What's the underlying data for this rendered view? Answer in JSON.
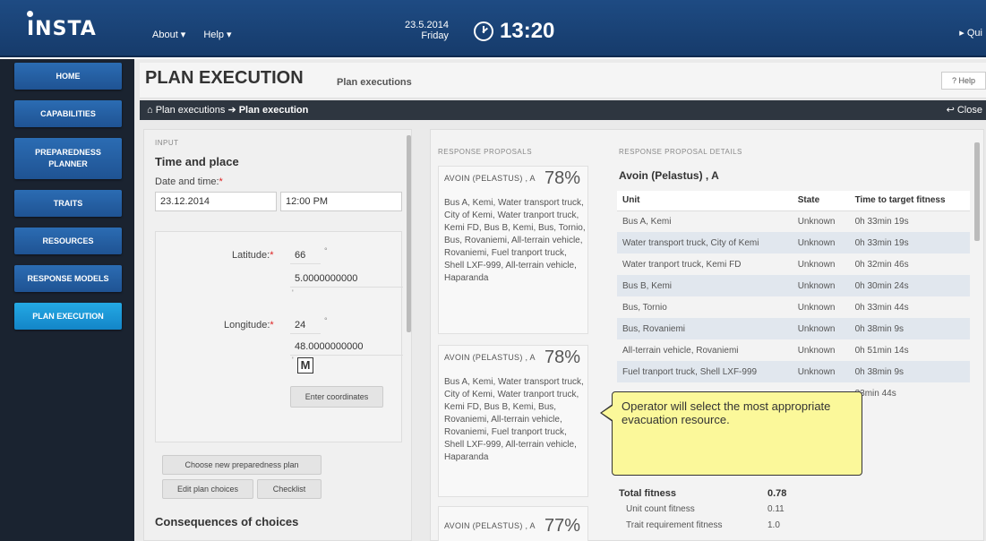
{
  "topbar": {
    "logo": "INSTA",
    "menu": [
      "About ▾",
      "Help ▾"
    ],
    "date": "23.5.2014",
    "day": "Friday",
    "time": "13:20",
    "quit": "▸ Qui"
  },
  "sidebar": {
    "items": [
      {
        "label": "HOME"
      },
      {
        "label": "CAPABILITIES"
      },
      {
        "label": "PREPAREDNESS PLANNER"
      },
      {
        "label": "TRAITS"
      },
      {
        "label": "RESOURCES"
      },
      {
        "label": "RESPONSE MODELS"
      },
      {
        "label": "PLAN EXECUTION"
      }
    ]
  },
  "header": {
    "title": "PLAN EXECUTION",
    "subtitle": "Plan executions",
    "help": "? Help"
  },
  "breadcrumb": {
    "home": "⌂ Plan executions",
    "arrow": "➔",
    "current": "Plan execution",
    "close": "↩ Close"
  },
  "input": {
    "section_label": "INPUT",
    "title": "Time and place",
    "date_label": "Date and time:",
    "date_value": "23.12.2014",
    "time_value": "12:00 PM",
    "latitude_label": "Latitude:",
    "latitude_deg": "66",
    "latitude_min": "5.0000000000",
    "longitude_label": "Longitude:",
    "longitude_deg": "24",
    "longitude_min": "48.0000000000",
    "deg_mark": "°",
    "min_mark": "'",
    "map_marker": "M",
    "enter_coords": "Enter coordinates",
    "choose_plan": "Choose new preparedness plan",
    "edit_choices": "Edit plan choices",
    "checklist": "Checklist",
    "consequences": "Consequences of choices"
  },
  "proposals": {
    "section_label": "RESPONSE PROPOSALS",
    "cards": [
      {
        "name": "AVOIN (PELASTUS) , A",
        "pct": "78%",
        "body": "Bus A, Kemi, Water transport truck, City of Kemi, Water tranport truck, Kemi FD, Bus B, Kemi, Bus, Tornio, Bus, Rovaniemi, All-terrain vehicle, Rovaniemi, Fuel tranport truck, Shell LXF-999, All-terrain vehicle, Haparanda"
      },
      {
        "name": "AVOIN (PELASTUS) , A",
        "pct": "78%",
        "body": "Bus A, Kemi, Water transport truck, City of Kemi, Water tranport truck, Kemi FD, Bus B, Kemi, Bus, Rovaniemi, All-terrain vehicle, Rovaniemi, Fuel tranport truck, Shell LXF-999, All-terrain vehicle, Haparanda"
      },
      {
        "name": "AVOIN (PELASTUS) , A",
        "pct": "77%",
        "body": ""
      }
    ]
  },
  "details": {
    "section_label": "RESPONSE PROPOSAL DETAILS",
    "title": "Avoin (Pelastus) , A",
    "columns": [
      "Unit",
      "State",
      "Time to target fitness"
    ],
    "rows": [
      {
        "unit": "Bus A, Kemi",
        "state": "Unknown",
        "time": "0h 33min 19s"
      },
      {
        "unit": "Water transport truck, City of Kemi",
        "state": "Unknown",
        "time": "0h 33min 19s"
      },
      {
        "unit": "Water tranport truck, Kemi FD",
        "state": "Unknown",
        "time": "0h 32min 46s"
      },
      {
        "unit": "Bus B, Kemi",
        "state": "Unknown",
        "time": "0h 30min 24s"
      },
      {
        "unit": "Bus, Tornio",
        "state": "Unknown",
        "time": "0h 33min 44s"
      },
      {
        "unit": "Bus, Rovaniemi",
        "state": "Unknown",
        "time": "0h 38min 9s"
      },
      {
        "unit": "All-terrain vehicle, Rovaniemi",
        "state": "Unknown",
        "time": "0h 51min 14s"
      },
      {
        "unit": "Fuel tranport truck, Shell LXF-999",
        "state": "Unknown",
        "time": "0h 38min 9s"
      },
      {
        "unit": "",
        "state": "",
        "time": "33min 44s"
      }
    ],
    "total_fitness_label": "Total fitness",
    "total_fitness": "0.78",
    "unit_count_label": "Unit count fitness",
    "unit_count": "0.11",
    "trait_label": "Trait requirement fitness",
    "trait": "1.0"
  },
  "callout": {
    "text": "Operator will select the most appropriate evacuation resource."
  }
}
